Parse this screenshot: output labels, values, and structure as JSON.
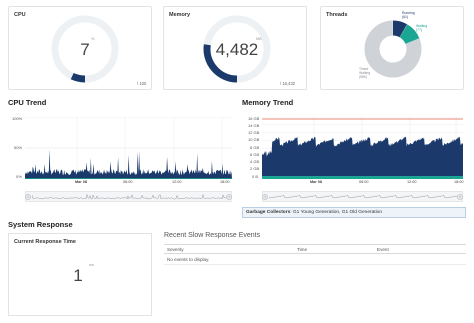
{
  "cpu": {
    "title": "CPU",
    "value": "7",
    "unit": "%",
    "max": "/ 100",
    "fraction": 0.07
  },
  "memory": {
    "title": "Memory",
    "value": "4,482",
    "unit": "MB",
    "max": "/ 16,432",
    "fraction": 0.2728
  },
  "threads": {
    "title": "Threads",
    "slices": [
      {
        "line1": "Running",
        "line2": "(61)",
        "value": 61,
        "color": "#1b3a6b"
      },
      {
        "line1": "Waiting",
        "line2": "(77)",
        "value": 77,
        "color": "#1aa693"
      },
      {
        "line1": "Timed Waiting",
        "line2": "(589)",
        "value": 589,
        "color": "#cfd3d8"
      }
    ]
  },
  "cpu_trend": {
    "title": "CPU Trend",
    "y_ticks": [
      "100%",
      "50%",
      "0%"
    ],
    "x_ticks": [
      "Mar 08",
      "06:00",
      "12:00",
      "18:00"
    ]
  },
  "memory_trend": {
    "title": "Memory Trend",
    "y_ticks": [
      "16 GB",
      "14 GB",
      "12 GB",
      "10 GB",
      "8 GB",
      "6 GB",
      "4 GB",
      "2 GB",
      "0 B"
    ],
    "x_ticks": [
      "Mar 08",
      "06:00",
      "12:00",
      "18:00"
    ]
  },
  "gc": {
    "label": "Garbage Collectors",
    "value": ": G1 Young Generation, G1 Old Generation"
  },
  "system_response": {
    "title": "System Response",
    "card_title": "Current Response Time",
    "value": "1",
    "unit": "ms"
  },
  "events": {
    "title": "Recent Slow Response Events",
    "columns": [
      "Severity",
      "Time",
      "Event"
    ],
    "empty_text": "No events to display."
  },
  "colors": {
    "primary": "#1b3a6b",
    "accent": "#1aa693",
    "max_line": "#e0614a",
    "track": "#eef1f4"
  }
}
